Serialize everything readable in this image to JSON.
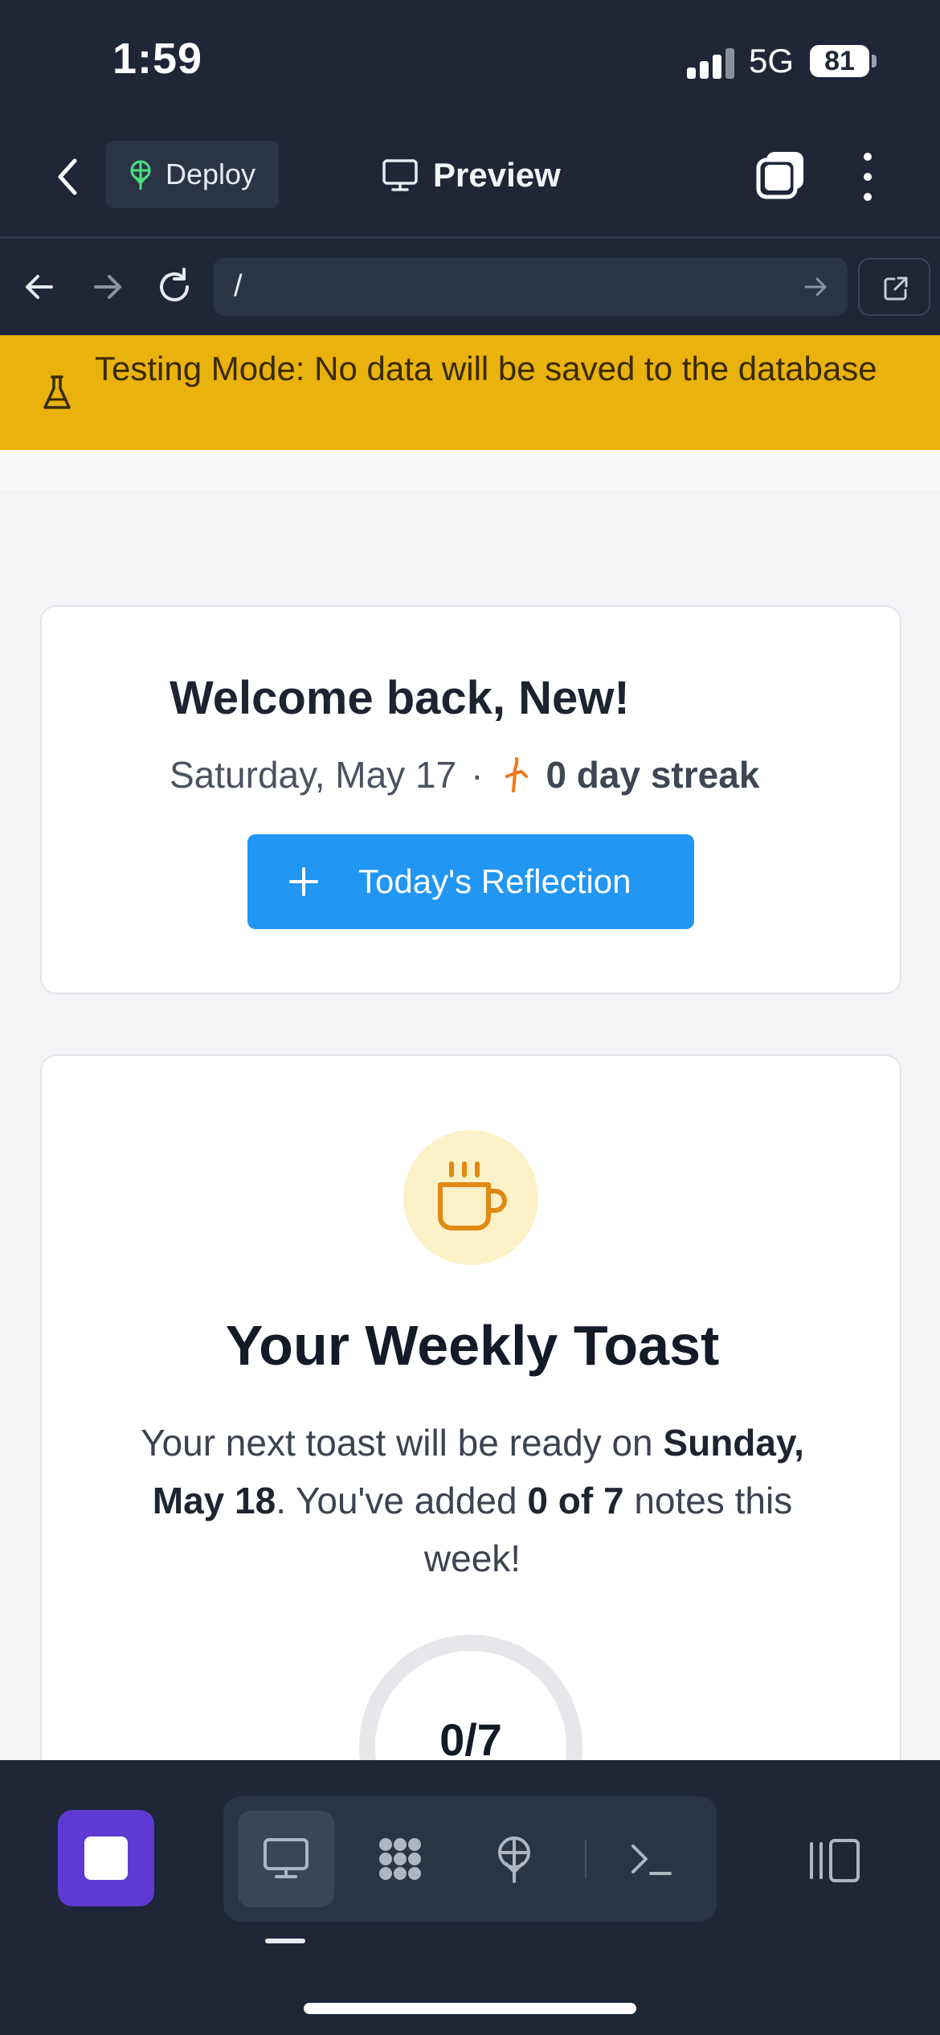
{
  "status_bar": {
    "time": "1:59",
    "network": "5G",
    "battery": "81"
  },
  "top_nav": {
    "deploy_label": "Deploy",
    "preview_title": "Preview"
  },
  "browser": {
    "url": "/"
  },
  "banner": {
    "text": "Testing Mode: No data will be saved to the database"
  },
  "welcome_card": {
    "title": "Welcome back, New!",
    "date": "Saturday, May 17",
    "separator": "·",
    "streak": "0 day streak",
    "cta_label": "Today's Reflection"
  },
  "toast_card": {
    "title": "Your Weekly Toast",
    "desc_part1": "Your next toast will be ready on ",
    "desc_date": "Sunday, May 18",
    "desc_part2": ". You've added ",
    "desc_count": "0 of 7",
    "desc_part3": " notes this week!",
    "progress_label": "0/7",
    "progress_fraction": 0
  },
  "colors": {
    "accent": "#2196f3",
    "banner": "#e9b20c",
    "stop_button": "#5d3bd3",
    "coffee": "#e08a14"
  },
  "icons": {
    "back": "chevron-left-icon",
    "deploy": "deploy-icon",
    "preview": "monitor-icon",
    "tabs": "tabs-icon",
    "more": "vertical-dots-icon",
    "flask": "flask-icon",
    "streak": "fire-icon",
    "coffee": "coffee-icon"
  }
}
